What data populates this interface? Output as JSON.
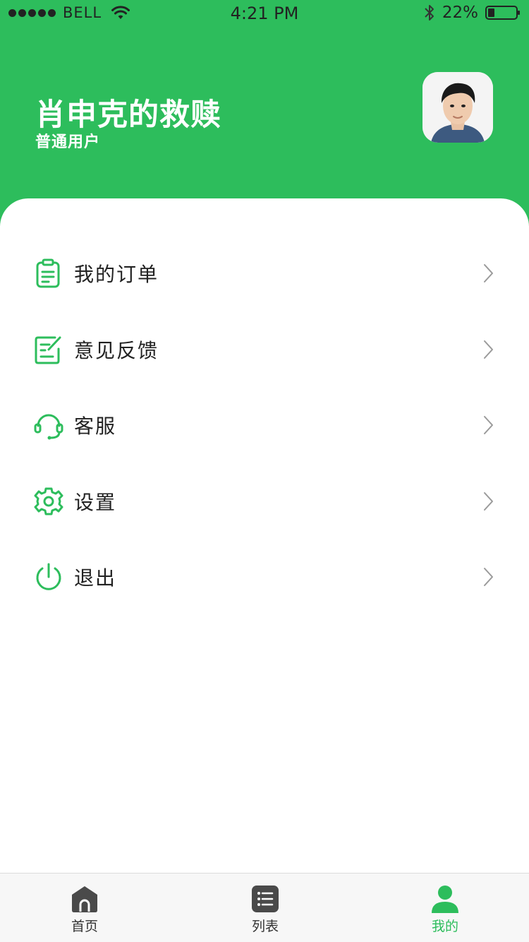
{
  "status_bar": {
    "carrier": "BELL",
    "time": "4:21 PM",
    "battery": "22%"
  },
  "profile": {
    "name": "肖申克的救赎",
    "role": "普通用户"
  },
  "menu": [
    {
      "label": "我的订单",
      "icon": "clipboard-icon"
    },
    {
      "label": "意见反馈",
      "icon": "feedback-edit-icon"
    },
    {
      "label": "客服",
      "icon": "headset-icon"
    },
    {
      "label": "设置",
      "icon": "gear-icon"
    },
    {
      "label": "退出",
      "icon": "power-icon"
    }
  ],
  "tabs": [
    {
      "label": "首页",
      "icon": "home-icon",
      "active": false
    },
    {
      "label": "列表",
      "icon": "list-icon",
      "active": false
    },
    {
      "label": "我的",
      "icon": "user-icon",
      "active": true
    }
  ],
  "colors": {
    "accent": "#2dbd5c",
    "tab_inactive_icon": "#4a4a4a",
    "chevron": "#9a9a9a"
  }
}
